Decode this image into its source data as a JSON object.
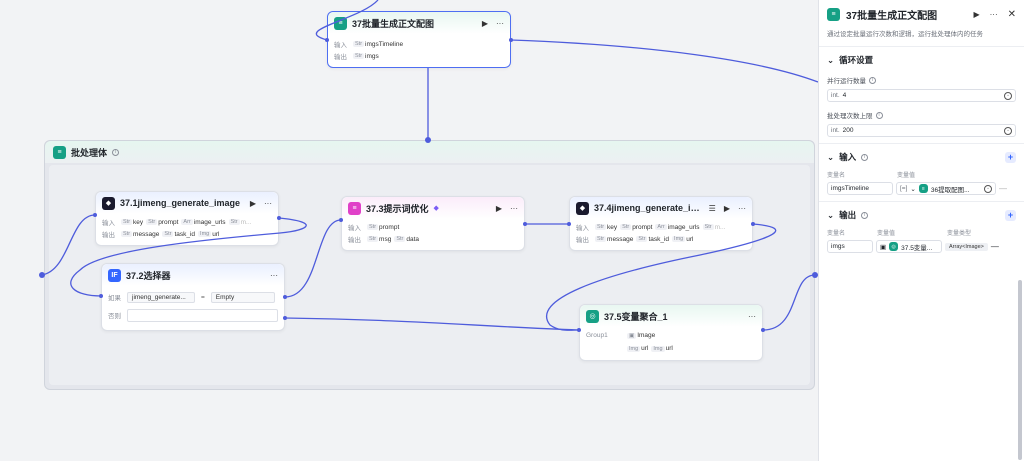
{
  "top_node": {
    "title": "37批量生成正文配图",
    "in_label": "输入",
    "in_type": "Str",
    "in_value": "imgsTimeline",
    "out_label": "输出",
    "out_type": "Str",
    "out_value": "imgs"
  },
  "group": {
    "title": "批处理体"
  },
  "node_37_1": {
    "title": "37.1jimeng_generate_image",
    "in_label": "输入",
    "in_items": [
      {
        "type": "Str",
        "name": "key"
      },
      {
        "type": "Str",
        "name": "prompt"
      },
      {
        "type": "Arr",
        "name": "image_urls"
      },
      {
        "type": "Str",
        "name": "m..."
      }
    ],
    "out_label": "输出",
    "out_items": [
      {
        "type": "Str",
        "name": "message"
      },
      {
        "type": "Str",
        "name": "task_id"
      },
      {
        "type": "Img",
        "name": "url"
      }
    ]
  },
  "node_37_2": {
    "title": "37.2选择器",
    "if_label": "如果",
    "cond_left": "jimeng_generate...",
    "cond_op": "=",
    "cond_right": "Empty",
    "else_label": "否则"
  },
  "node_37_3": {
    "title": "37.3提示词优化",
    "in_label": "输入",
    "in_items": [
      {
        "type": "Str",
        "name": "prompt"
      }
    ],
    "out_label": "输出",
    "out_items": [
      {
        "type": "Str",
        "name": "msg"
      },
      {
        "type": "Str",
        "name": "data"
      }
    ]
  },
  "node_37_4": {
    "title": "37.4jimeng_generate_imag...",
    "in_label": "输入",
    "in_items": [
      {
        "type": "Str",
        "name": "key"
      },
      {
        "type": "Str",
        "name": "prompt"
      },
      {
        "type": "Arr",
        "name": "image_urls"
      },
      {
        "type": "Str",
        "name": "m..."
      }
    ],
    "out_label": "输出",
    "out_items": [
      {
        "type": "Str",
        "name": "message"
      },
      {
        "type": "Str",
        "name": "task_id"
      },
      {
        "type": "Img",
        "name": "url"
      }
    ]
  },
  "node_37_5": {
    "title": "37.5变量聚合_1",
    "group_label": "Group1",
    "group_type": "Image",
    "items": [
      {
        "type": "Img",
        "name": "url"
      },
      {
        "type": "Img",
        "name": "url"
      }
    ]
  },
  "panel": {
    "title": "37批量生成正文配图",
    "desc": "通过设定批量运行次数和逻辑，运行批处理体内的任务",
    "loop_section": "循环设置",
    "parallel_label": "并行运行数量",
    "parallel_type": "int.",
    "parallel_value": "4",
    "max_label": "批处理次数上限",
    "max_type": "int.",
    "max_value": "200",
    "input_section": "输入",
    "col_var_name": "变量名",
    "col_var_value": "变量值",
    "col_var_type": "变量类型",
    "input_var_name": "imgsTimeline",
    "input_var_type": "[=]",
    "input_var_value": "36提取配图...",
    "output_section": "输出",
    "output_var_name": "imgs",
    "output_var_value": "37.5变量...",
    "output_var_type": "Array<Image>"
  },
  "colors": {
    "accent": "#4e6ef2",
    "edge": "#4e5cdc",
    "group_icon": "#16a085"
  }
}
